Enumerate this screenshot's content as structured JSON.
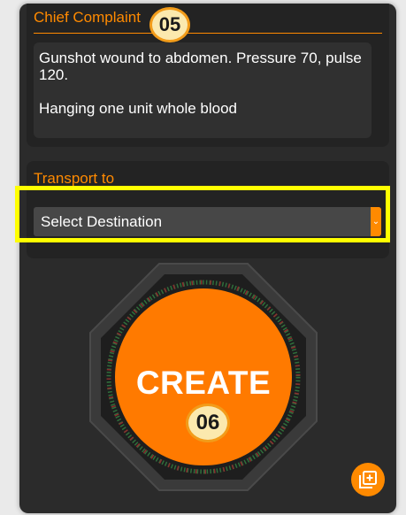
{
  "chief_complaint": {
    "label": "Chief Complaint",
    "badge": "05",
    "notes_line1": "Gunshot wound to abdomen. Pressure 70, pulse 120.",
    "notes_line2": "Hanging one unit whole blood"
  },
  "transport": {
    "label": "Transport to",
    "select_value": "Select Destination"
  },
  "create": {
    "label": "CREATE",
    "badge": "06"
  },
  "colors": {
    "accent": "#ff8a00",
    "highlight": "#ffff00",
    "badge_fill": "#fbe9ae"
  },
  "icons": {
    "select_arrow": "chevron-down-icon",
    "add_button": "add-copy-icon"
  }
}
